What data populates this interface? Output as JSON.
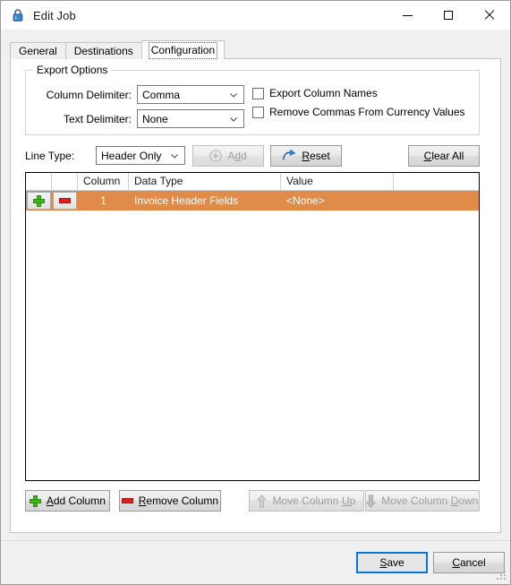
{
  "window": {
    "title": "Edit Job",
    "icon": "lock-icon",
    "controls": {
      "minimize": "minimize-icon",
      "maximize": "maximize-icon",
      "close": "close-icon"
    }
  },
  "tabs": [
    {
      "label": "General",
      "selected": false
    },
    {
      "label": "Destinations",
      "selected": false
    },
    {
      "label": "Configuration",
      "selected": true
    }
  ],
  "export_options": {
    "legend": "Export Options",
    "column_delimiter": {
      "label": "Column Delimiter:",
      "value": "Comma"
    },
    "text_delimiter": {
      "label": "Text Delimiter:",
      "value": "None"
    },
    "checkboxes": [
      {
        "label": "Export Column Names",
        "checked": false
      },
      {
        "label": "Remove Commas From Currency Values",
        "checked": false
      }
    ]
  },
  "line_type": {
    "label": "Line Type:",
    "value": "Header Only",
    "add_button": {
      "label": "Add",
      "accel": "d",
      "enabled": false,
      "icon": "plus-circle-icon"
    },
    "reset_button": {
      "label": "Reset",
      "accel": "R",
      "enabled": true,
      "icon": "reset-arrow-icon"
    },
    "clear_all_button": {
      "label": "Clear All",
      "accel": "C",
      "enabled": true
    }
  },
  "grid": {
    "columns": [
      "",
      "",
      "Column",
      "Data Type",
      "Value",
      ""
    ],
    "rows": [
      {
        "add_icon": "plus-icon",
        "remove_icon": "minus-icon",
        "column": "1",
        "data_type": "Invoice Header Fields",
        "value": "<None>",
        "selected": true
      }
    ]
  },
  "grid_buttons": [
    {
      "label": "Add Column",
      "accel": "A",
      "enabled": true,
      "icon": "plus-icon"
    },
    {
      "label": "Remove Column",
      "accel": "R",
      "enabled": true,
      "icon": "minus-icon"
    },
    {
      "label": "Move Column Up",
      "accel": "U",
      "enabled": false,
      "icon": "arrow-up-icon"
    },
    {
      "label": "Move Column Down",
      "accel": "D",
      "enabled": false,
      "icon": "arrow-down-icon"
    }
  ],
  "footer": {
    "save": {
      "label": "Save",
      "accel": "S",
      "default": true
    },
    "cancel": {
      "label": "Cancel",
      "accel": "C",
      "default": false
    }
  },
  "colors": {
    "selected_row": "#e08b49",
    "accent_focus": "#0078d7",
    "green": "#3cb815",
    "red": "#e02020"
  }
}
